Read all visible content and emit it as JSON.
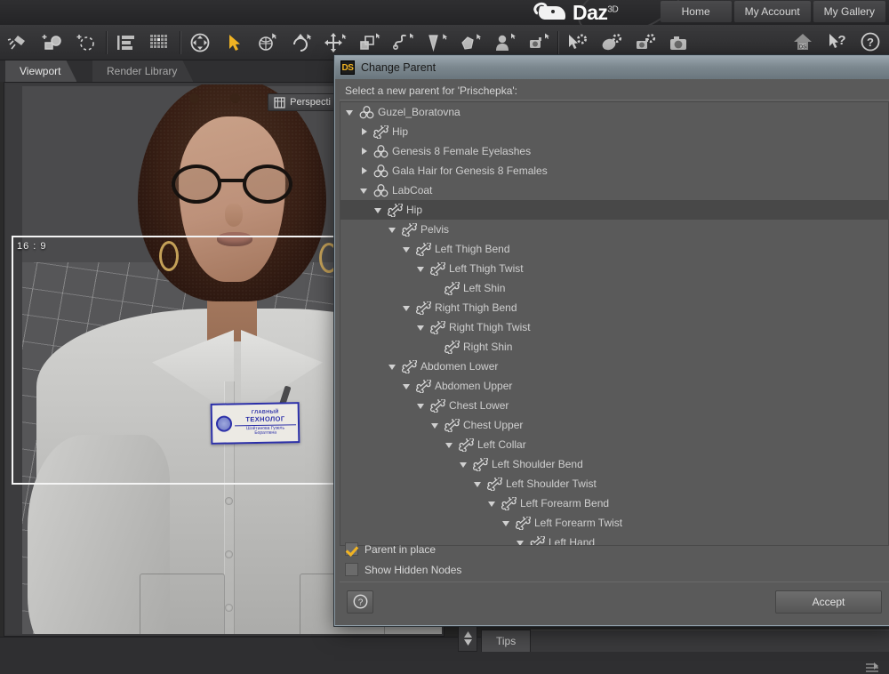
{
  "brand": {
    "name": "Daz",
    "superscript": "3D",
    "nav": [
      {
        "label": "Home",
        "name": "nav-home"
      },
      {
        "label": "My Account",
        "name": "nav-my-account"
      },
      {
        "label": "My Gallery",
        "name": "nav-my-gallery"
      }
    ]
  },
  "toolbar": {
    "items": [
      {
        "name": "spotlight-tool-icon",
        "title": "Create Spotlight"
      },
      {
        "name": "add-camera-icon",
        "title": "Create Camera"
      },
      {
        "name": "add-group-icon",
        "title": "Create Group"
      },
      {
        "name": "scene-list-icon",
        "title": "Scene"
      },
      {
        "name": "grid-layout-icon",
        "title": "Layout"
      },
      {
        "name": "universal-manip-icon",
        "title": "Universal Tool"
      },
      {
        "name": "node-selection-icon",
        "title": "Node Selection Tool"
      },
      {
        "name": "rotate-orbit-icon",
        "title": "Rotate Tool"
      },
      {
        "name": "rotate-tool-icon",
        "title": "Rotate"
      },
      {
        "name": "translate-tool-icon",
        "title": "Translate Tool"
      },
      {
        "name": "scale-tool-icon",
        "title": "Scale Tool"
      },
      {
        "name": "bone-tool-icon",
        "title": "Joint Editor"
      },
      {
        "name": "mesh-tool-icon",
        "title": "Mesh Grabber"
      },
      {
        "name": "surface-selection-icon",
        "title": "Surface Selection Tool"
      },
      {
        "name": "figure-select-icon",
        "title": "Figure Tool"
      },
      {
        "name": "camera-select-icon",
        "title": "Camera Tool"
      },
      {
        "name": "pointer-settings-icon",
        "title": "Tool Settings"
      },
      {
        "name": "render-settings-icon",
        "title": "Render Settings"
      },
      {
        "name": "camera-settings-icon",
        "title": "Camera Settings"
      },
      {
        "name": "render-camera-icon",
        "title": "Render"
      }
    ],
    "right_items": [
      {
        "name": "daz-home-icon",
        "title": "Daz Home"
      },
      {
        "name": "context-help-icon",
        "title": "Context Help"
      },
      {
        "name": "help-icon",
        "title": "Help"
      }
    ]
  },
  "tabs": [
    {
      "label": "Viewport",
      "name": "tab-viewport",
      "active": true
    },
    {
      "label": "Render Library",
      "name": "tab-render-library",
      "active": false
    }
  ],
  "viewport": {
    "camera_label": "Perspecti",
    "aspect_label": "16 : 9",
    "badge": {
      "line1": "ГЛАВНЫЙ",
      "line2": "ТЕХНОЛОГ",
      "line3": "Шлётинова Гузель Боратовна"
    }
  },
  "dialog": {
    "title": "Change Parent",
    "icon_label": "DS",
    "prompt": "Select a new parent for 'Prischepka':",
    "tree": [
      {
        "label": "Guzel_Boratovna",
        "depth": 0,
        "icon": "figure-icon",
        "arrow": "open",
        "selected": false
      },
      {
        "label": "Hip",
        "depth": 1,
        "icon": "bone-icon",
        "arrow": "closed",
        "selected": false
      },
      {
        "label": "Genesis 8 Female Eyelashes",
        "depth": 1,
        "icon": "figure-icon",
        "arrow": "closed",
        "selected": false
      },
      {
        "label": "Gala Hair for Genesis 8 Females",
        "depth": 1,
        "icon": "figure-icon",
        "arrow": "closed",
        "selected": false
      },
      {
        "label": "LabCoat",
        "depth": 1,
        "icon": "figure-icon",
        "arrow": "open",
        "selected": false
      },
      {
        "label": "Hip",
        "depth": 2,
        "icon": "bone-icon",
        "arrow": "open",
        "selected": true
      },
      {
        "label": "Pelvis",
        "depth": 3,
        "icon": "bone-icon",
        "arrow": "open",
        "selected": false
      },
      {
        "label": "Left Thigh Bend",
        "depth": 4,
        "icon": "bone-icon",
        "arrow": "open",
        "selected": false
      },
      {
        "label": "Left Thigh Twist",
        "depth": 5,
        "icon": "bone-icon",
        "arrow": "open",
        "selected": false
      },
      {
        "label": "Left Shin",
        "depth": 6,
        "icon": "bone-icon",
        "arrow": "none",
        "selected": false
      },
      {
        "label": "Right Thigh Bend",
        "depth": 4,
        "icon": "bone-icon",
        "arrow": "open",
        "selected": false
      },
      {
        "label": "Right Thigh Twist",
        "depth": 5,
        "icon": "bone-icon",
        "arrow": "open",
        "selected": false
      },
      {
        "label": "Right Shin",
        "depth": 6,
        "icon": "bone-icon",
        "arrow": "none",
        "selected": false
      },
      {
        "label": "Abdomen Lower",
        "depth": 3,
        "icon": "bone-icon",
        "arrow": "open",
        "selected": false
      },
      {
        "label": "Abdomen Upper",
        "depth": 4,
        "icon": "bone-icon",
        "arrow": "open",
        "selected": false
      },
      {
        "label": "Chest Lower",
        "depth": 5,
        "icon": "bone-icon",
        "arrow": "open",
        "selected": false
      },
      {
        "label": "Chest Upper",
        "depth": 6,
        "icon": "bone-icon",
        "arrow": "open",
        "selected": false
      },
      {
        "label": "Left Collar",
        "depth": 7,
        "icon": "bone-icon",
        "arrow": "open",
        "selected": false
      },
      {
        "label": "Left Shoulder Bend",
        "depth": 8,
        "icon": "bone-icon",
        "arrow": "open",
        "selected": false
      },
      {
        "label": "Left Shoulder Twist",
        "depth": 9,
        "icon": "bone-icon",
        "arrow": "open",
        "selected": false
      },
      {
        "label": "Left Forearm Bend",
        "depth": 10,
        "icon": "bone-icon",
        "arrow": "open",
        "selected": false
      },
      {
        "label": "Left Forearm Twist",
        "depth": 11,
        "icon": "bone-icon",
        "arrow": "open",
        "selected": false
      },
      {
        "label": "Left Hand",
        "depth": 12,
        "icon": "bone-icon",
        "arrow": "open",
        "selected": false
      }
    ],
    "checkboxes": [
      {
        "label": "Parent in place",
        "checked": true,
        "name": "parent-in-place-checkbox"
      },
      {
        "label": "Show Hidden Nodes",
        "checked": false,
        "name": "show-hidden-nodes-checkbox"
      }
    ],
    "accept_label": "Accept",
    "help_label": "?"
  },
  "statusbar": {
    "tips_label": "Tips"
  },
  "colors": {
    "accent": "#f0b323",
    "dialog_bg": "#5a5a5a",
    "titlebar": "#7d8990",
    "selection": "#484848",
    "text": "#cfcfcf"
  }
}
